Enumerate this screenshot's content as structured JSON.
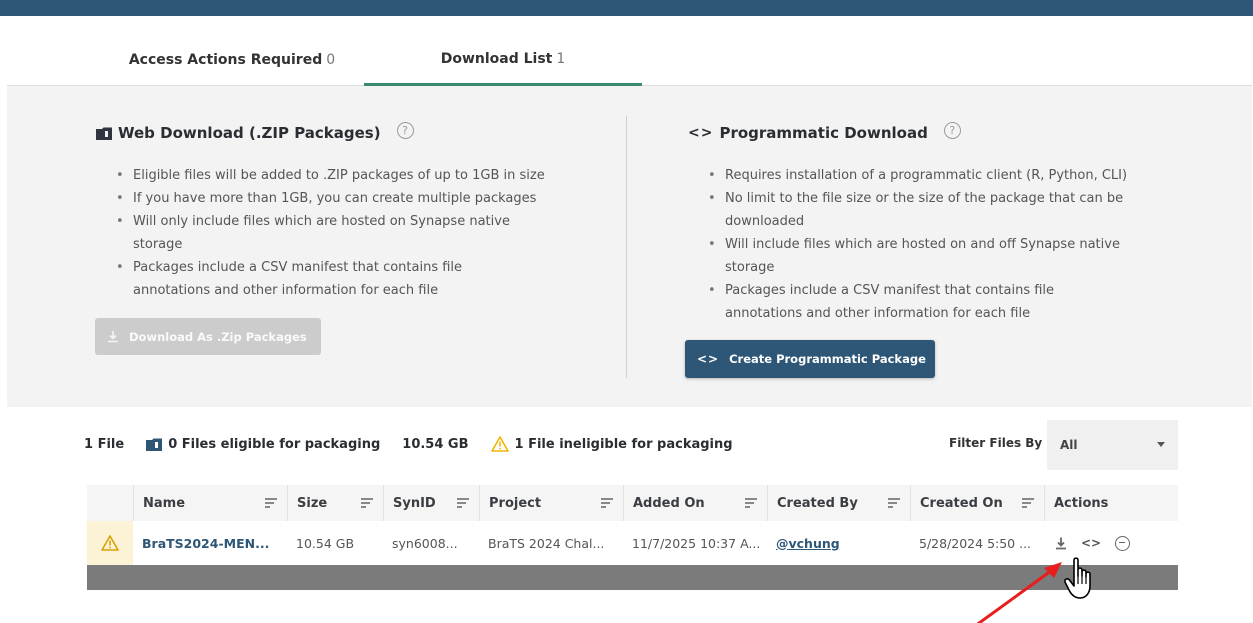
{
  "colors": {
    "accent": "#2e5677",
    "tab_active": "#3b8a6e",
    "warning": "#f2b705"
  },
  "tabs": [
    {
      "label": "Access Actions Required",
      "count": "0"
    },
    {
      "label": "Download List",
      "count": "1"
    }
  ],
  "web_download": {
    "title": "Web Download (.ZIP Packages)",
    "bullets": [
      "Eligible files will be added to .ZIP packages of up to 1GB in size",
      "If you have more than 1GB, you can create multiple packages",
      "Will only include files which are hosted on Synapse native",
      "storage",
      "Packages include a CSV manifest that contains file",
      "annotations and other information for each file"
    ],
    "button_label": "Download As .Zip Packages"
  },
  "programmatic": {
    "title": "Programmatic Download",
    "bullets": [
      "Requires installation of a programmatic client (R, Python, CLI)",
      "No limit to the file size or the size of the package that can be",
      "downloaded",
      "Will include files which are hosted on and off Synapse native",
      "storage",
      "Packages include a CSV manifest that contains file",
      "annotations and other information for each file"
    ],
    "button_label": "Create Programmatic Package"
  },
  "summary": {
    "file_count": "1 File",
    "eligible": "0 Files eligible for packaging",
    "size": "10.54 GB",
    "ineligible": "1 File ineligible for packaging"
  },
  "filter": {
    "label": "Filter Files By",
    "selected": "All"
  },
  "table": {
    "headers": [
      "Name",
      "Size",
      "SynID",
      "Project",
      "Added On",
      "Created By",
      "Created On",
      "Actions"
    ],
    "row": {
      "name": "BraTS2024-MEN...",
      "size": "10.54 GB",
      "synid": "syn6008...",
      "project": "BraTS 2024 Chal...",
      "added_on": "11/7/2025 10:37 A...",
      "created_by": "@vchung",
      "created_on": "5/28/2024 5:50 ..."
    }
  }
}
